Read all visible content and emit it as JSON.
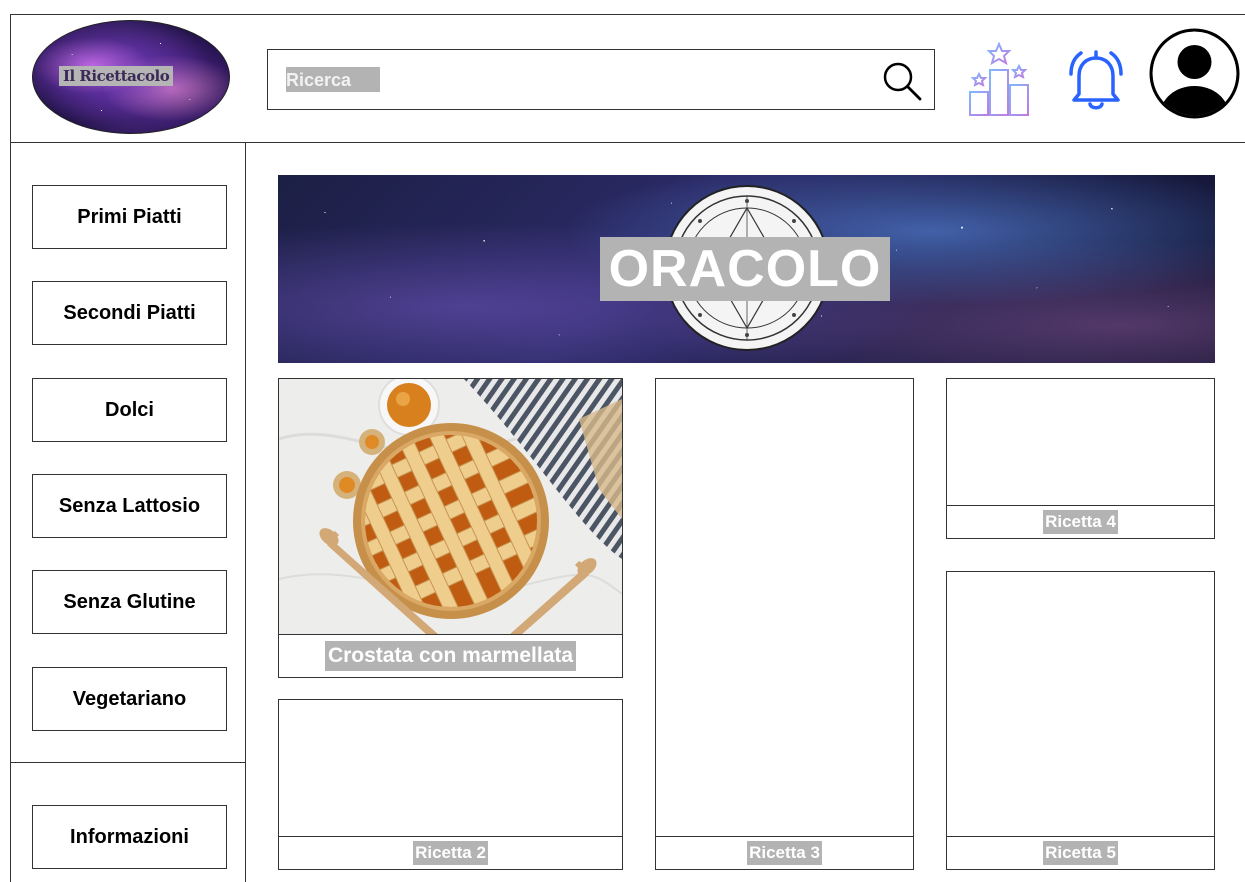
{
  "header": {
    "logo_text": "Il Ricettacolo",
    "search_placeholder": "Ricerca"
  },
  "sidebar": {
    "items": [
      {
        "label": "Primi Piatti"
      },
      {
        "label": "Secondi Piatti"
      },
      {
        "label": "Dolci"
      },
      {
        "label": "Senza Lattosio"
      },
      {
        "label": "Senza Glutine"
      },
      {
        "label": "Vegetariano"
      }
    ],
    "info_label": "Informazioni"
  },
  "banner": {
    "title": "ORACOLO"
  },
  "recipes": [
    {
      "title": "Crostata con marmellata"
    },
    {
      "title": "Ricetta 2"
    },
    {
      "title": "Ricetta 3"
    },
    {
      "title": "Ricetta 4"
    },
    {
      "title": "Ricetta 5"
    }
  ],
  "icons": {
    "search": "search-icon",
    "ranking": "ranking-podium-icon",
    "notifications": "bell-icon",
    "profile": "user-avatar-icon"
  },
  "colors": {
    "label_highlight": "#b3b3b3",
    "ranking_icon": "#9b7bdc",
    "bell_icon": "#2a62ff",
    "border": "#333333"
  }
}
